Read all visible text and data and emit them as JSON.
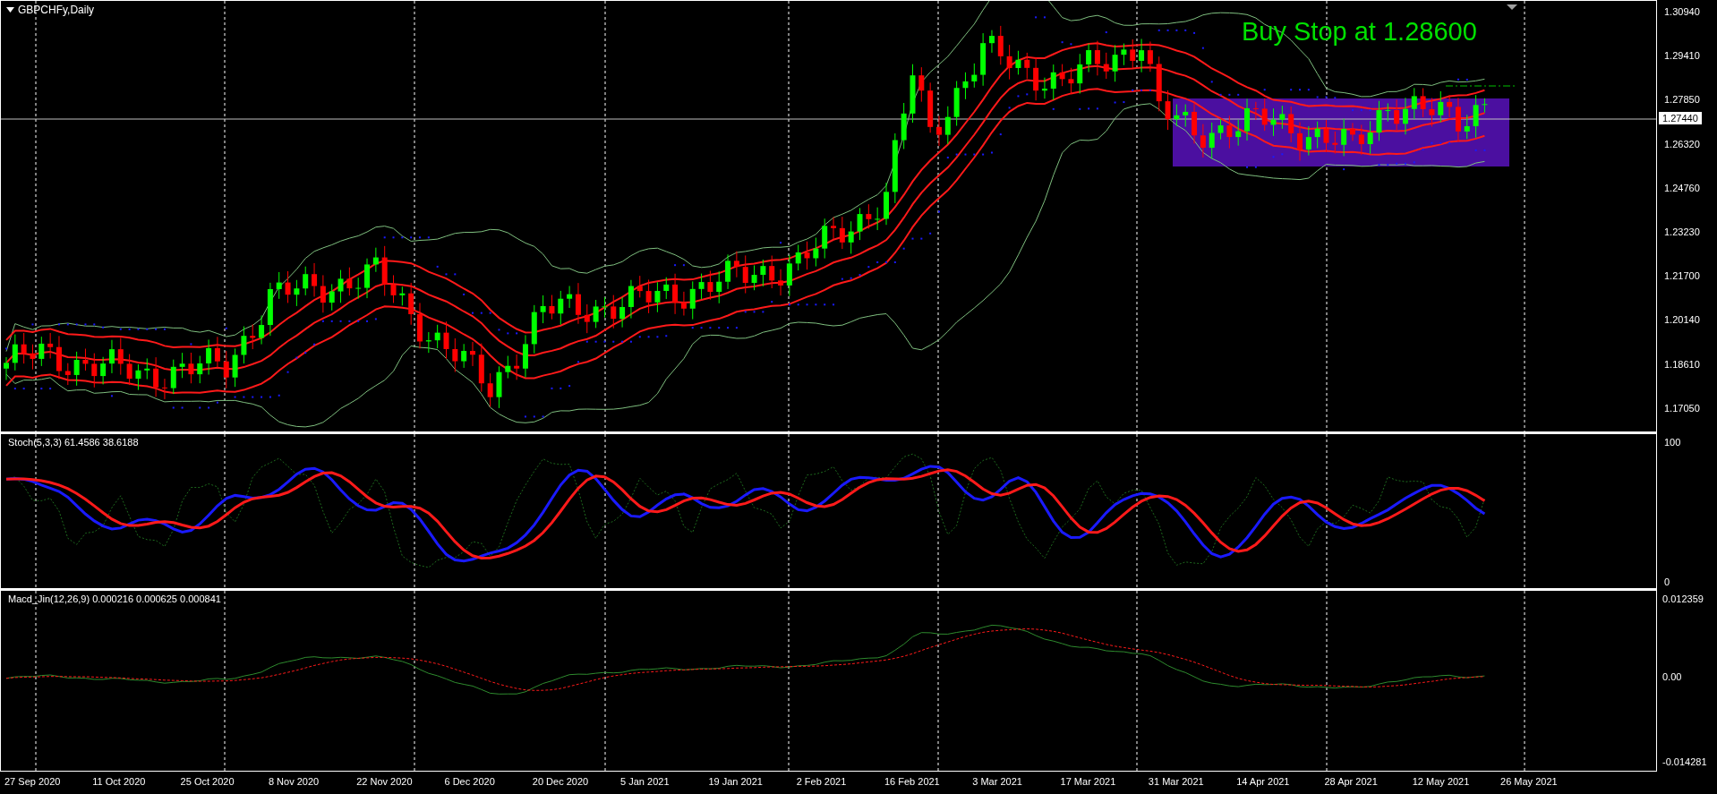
{
  "chart": {
    "title": "GBPCHFy,Daily",
    "annotation": "Buy Stop at 1.28600",
    "current_price": "1.27440",
    "price_axis": [
      "1.30940",
      "1.29410",
      "1.27850",
      "1.26320",
      "1.24760",
      "1.23230",
      "1.21700",
      "1.20140",
      "1.18610",
      "1.17050"
    ]
  },
  "stochastic": {
    "label": "Stoch(5,3,3) 61.4586 38.6188",
    "axis": [
      "100",
      "0"
    ]
  },
  "macd": {
    "label": "Macd_Jin(12,26,9) 0.000216 0.000625 0.000841",
    "axis": [
      "0.012359",
      "0.00",
      "-0.014281"
    ]
  },
  "time_axis": [
    "27 Sep 2020",
    "11 Oct 2020",
    "25 Oct 2020",
    "8 Nov 2020",
    "22 Nov 2020",
    "6 Dec 2020",
    "20 Dec 2020",
    "5 Jan 2021",
    "19 Jan 2021",
    "2 Feb 2021",
    "16 Feb 2021",
    "3 Mar 2021",
    "17 Mar 2021",
    "31 Mar 2021",
    "14 Apr 2021",
    "28 Apr 2021",
    "12 May 2021",
    "26 May 2021"
  ]
}
